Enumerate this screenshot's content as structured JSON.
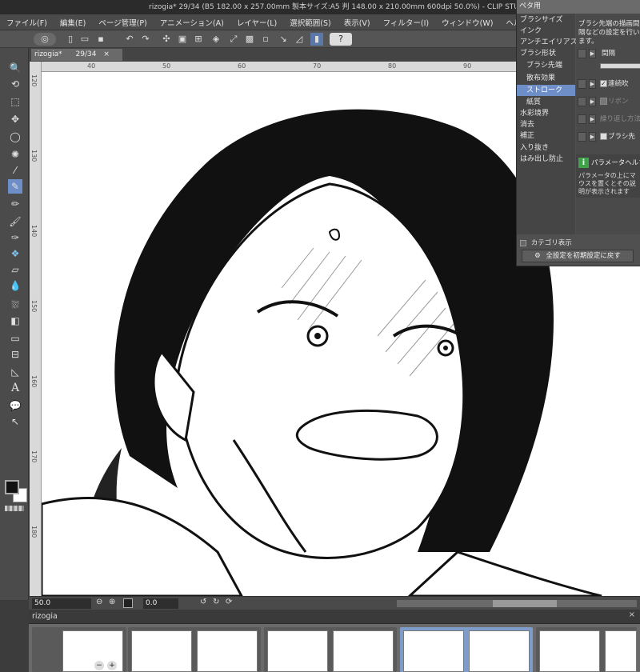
{
  "title": "rizogia* 29/34 (B5 182.00 x 257.00mm 製本サイズ:A5 判 148.00 x 210.00mm 600dpi 50.0%) - CLIP STUDIO PAINT",
  "menu": [
    "ファイル(F)",
    "編集(E)",
    "ページ管理(P)",
    "アニメーション(A)",
    "レイヤー(L)",
    "選択範囲(S)",
    "表示(V)",
    "フィルター(I)",
    "ウィンドウ(W)",
    "ヘルプ(H)"
  ],
  "doc_tab": {
    "name": "rizogia*",
    "pages": "29/34"
  },
  "ruler_top": [
    "40",
    "50",
    "60",
    "70",
    "80",
    "90"
  ],
  "ruler_left": [
    "120",
    "130",
    "140",
    "150",
    "160",
    "170",
    "180"
  ],
  "status": {
    "zoom": "50.0",
    "rotation": "0.0"
  },
  "pages_panel": {
    "tab": "rizogia"
  },
  "props": {
    "header": "ペタ用",
    "categories": [
      {
        "label": "ブラシサイズ",
        "level": 0,
        "selected": false
      },
      {
        "label": "インク",
        "level": 0,
        "selected": false
      },
      {
        "label": "アンチエイリアス",
        "level": 0,
        "selected": false
      },
      {
        "label": "ブラシ形状",
        "level": 0,
        "selected": false
      },
      {
        "label": "ブラシ先端",
        "level": 1,
        "selected": false
      },
      {
        "label": "散布効果",
        "level": 1,
        "selected": false
      },
      {
        "label": "ストローク",
        "level": 1,
        "selected": true
      },
      {
        "label": "紙質",
        "level": 1,
        "selected": false
      },
      {
        "label": "水彩境界",
        "level": 0,
        "selected": false
      },
      {
        "label": "消去",
        "level": 0,
        "selected": false
      },
      {
        "label": "補正",
        "level": 0,
        "selected": false
      },
      {
        "label": "入り抜き",
        "level": 0,
        "selected": false
      },
      {
        "label": "はみ出し防止",
        "level": 0,
        "selected": false
      }
    ],
    "desc": "ブラシ先端の描画間隔などの設定を行います。",
    "params": [
      {
        "label": "間隔",
        "check": false,
        "dim": false
      },
      {
        "label": "連続吹",
        "check": true,
        "dim": false
      },
      {
        "label": "リボン",
        "check": false,
        "dim": true
      },
      {
        "label": "繰り返し方法",
        "check": false,
        "dim": true
      },
      {
        "label": "ブラシ先",
        "check": false,
        "dim": false
      }
    ],
    "help_title": "パラメータヘルプ",
    "help_text": "パラメータの上にマウスを置くとその説明が表示されます",
    "category_toggle": "カテゴリ表示",
    "reset": "全設定を初期設定に戻す"
  }
}
